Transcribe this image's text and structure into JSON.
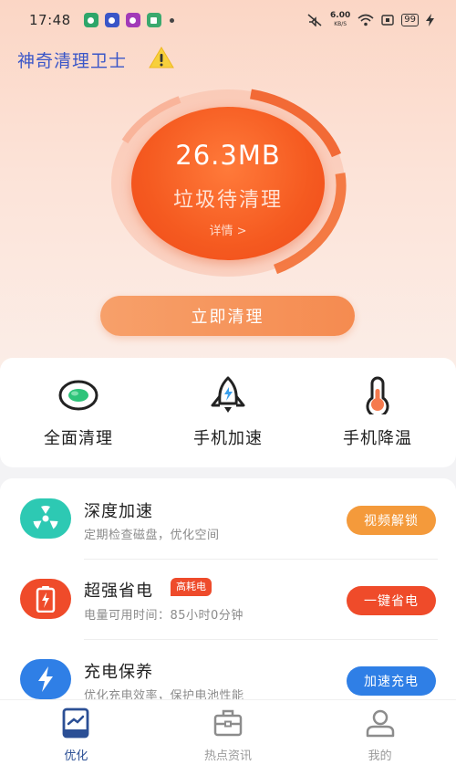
{
  "status_bar": {
    "time": "17:48",
    "net_speed_value": "6.00",
    "net_speed_unit": "KB/S",
    "battery": "99",
    "notification_colors": [
      "#2ea66a",
      "#3a56c8",
      "#a23ab8",
      "#3aa96e"
    ]
  },
  "header": {
    "title": "神奇清理卫士",
    "warning_icon": "warning-icon"
  },
  "gauge": {
    "value": "26.3MB",
    "label": "垃圾待清理",
    "detail": "详情 >"
  },
  "primary_action": {
    "label": "立即清理"
  },
  "quick_actions": [
    {
      "label": "全面清理",
      "icon": "cleaner-pill-icon"
    },
    {
      "label": "手机加速",
      "icon": "rocket-icon"
    },
    {
      "label": "手机降温",
      "icon": "thermometer-icon"
    }
  ],
  "features": [
    {
      "title": "深度加速",
      "subtitle": "定期检查磁盘，优化空间",
      "button": "视频解锁",
      "icon": "fan-radiation-icon",
      "icon_color": "#2dc9b3",
      "button_color": "#f49a3b"
    },
    {
      "title": "超强省电",
      "subtitle": "电量可用时间：85小时0分钟",
      "button": "一键省电",
      "badge": "高耗电",
      "icon": "battery-charge-icon",
      "icon_color": "#ef4b2a",
      "button_color": "#ef4b2a"
    },
    {
      "title": "充电保养",
      "subtitle": "优化充电效率，保护电池性能",
      "button": "加速充电",
      "icon": "lightning-icon",
      "icon_color": "#2f7fe6",
      "button_color": "#2f7fe6"
    }
  ],
  "bottom_nav": [
    {
      "label": "优化",
      "icon": "optimize-icon",
      "active": true
    },
    {
      "label": "热点资讯",
      "icon": "news-briefcase-icon",
      "active": false
    },
    {
      "label": "我的",
      "icon": "profile-icon",
      "active": false
    }
  ],
  "colors": {
    "accent": "#f55a20",
    "title_blue": "#3a56c8",
    "nav_active": "#2b4f95"
  }
}
